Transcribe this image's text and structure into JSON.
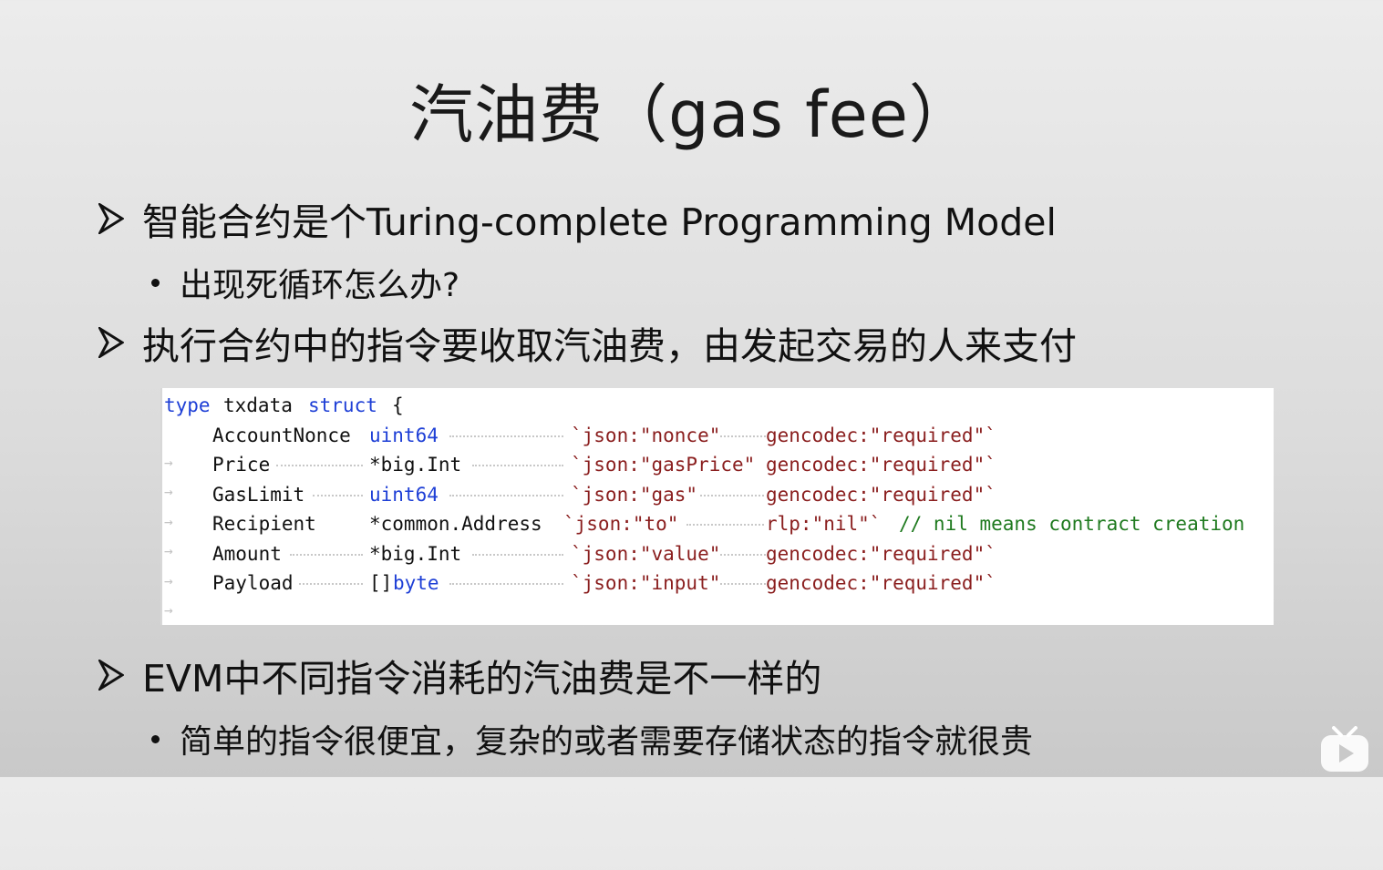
{
  "title": "汽油费（gas fee）",
  "bullets": [
    {
      "text": "智能合约是个Turing-complete Programming Model"
    },
    {
      "text": "出现死循环怎么办?"
    },
    {
      "text": "执行合约中的指令要收取汽油费，由发起交易的人来支付"
    },
    {
      "text": "EVM中不同指令消耗的汽油费是不一样的"
    },
    {
      "text": "简单的指令很便宜，复杂的或者需要存储状态的指令就很贵"
    }
  ],
  "code": {
    "header": {
      "kw1": "type",
      "name": "txdata",
      "kw2": "struct",
      "brace": "{"
    },
    "rows": [
      {
        "field": "AccountNonce",
        "type_prefix": "",
        "type": "uint64",
        "tag": "`json:\"nonce\"",
        "tag2": "gencodec:\"required\"`",
        "comment": ""
      },
      {
        "field": "Price",
        "type_prefix": "*big.Int",
        "type": "",
        "tag": "`json:\"gasPrice\"",
        "tag2": "gencodec:\"required\"`",
        "comment": ""
      },
      {
        "field": "GasLimit",
        "type_prefix": "",
        "type": "uint64",
        "tag": "`json:\"gas\"",
        "tag2": "gencodec:\"required\"`",
        "comment": ""
      },
      {
        "field": "Recipient",
        "type_prefix": "*common.Address",
        "type": "",
        "tag": "`json:\"to\"",
        "tag2": "rlp:\"nil\"`",
        "comment": "// nil means contract creation"
      },
      {
        "field": "Amount",
        "type_prefix": "*big.Int",
        "type": "",
        "tag": "`json:\"value\"",
        "tag2": "gencodec:\"required\"`",
        "comment": ""
      },
      {
        "field": "Payload",
        "type_prefix": "[]",
        "type": "byte",
        "tag": "`json:\"input\"",
        "tag2": "gencodec:\"required\"`",
        "comment": ""
      }
    ]
  },
  "colors": {
    "keyword": "#1e3fd6",
    "string": "#8a1e1e",
    "comment": "#1f7a1f"
  },
  "icons": {
    "bullet_level1": "arrowhead-bullet-icon",
    "bullet_level2": "round-dot-bullet-icon",
    "player": "video-player-tv-icon"
  }
}
